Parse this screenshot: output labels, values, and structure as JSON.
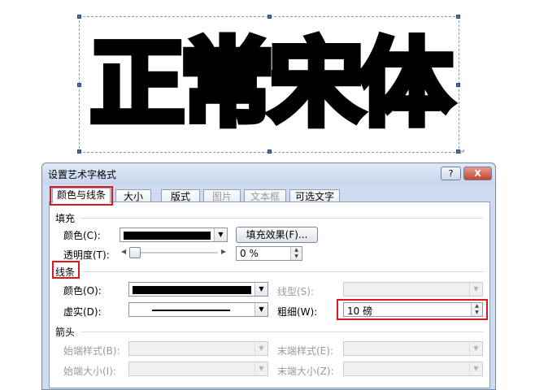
{
  "wordart": {
    "text": "正常宋体"
  },
  "dialog": {
    "title": "设置艺术字格式",
    "help_label": "?",
    "close_label": "X",
    "tabs": [
      {
        "label": "颜色与线条",
        "active": true,
        "enabled": true
      },
      {
        "label": "大小",
        "active": false,
        "enabled": true
      },
      {
        "label": "版式",
        "active": false,
        "enabled": true
      },
      {
        "label": "图片",
        "active": false,
        "enabled": false
      },
      {
        "label": "文本框",
        "active": false,
        "enabled": false
      },
      {
        "label": "可选文字",
        "active": false,
        "enabled": true
      }
    ],
    "fill": {
      "section_label": "填充",
      "color_label": "颜色(C):",
      "color_value": "#000000",
      "effects_button": "填充效果(F)...",
      "transparency_label": "透明度(T):",
      "transparency_value": "0 %",
      "transparency_percent": 0
    },
    "line": {
      "section_label": "线条",
      "color_label": "颜色(O):",
      "color_value": "#000000",
      "style_label": "线型(S):",
      "dash_label": "虚实(D):",
      "weight_label": "粗细(W):",
      "weight_value": "10 磅"
    },
    "arrows": {
      "section_label": "箭头",
      "begin_style_label": "始端样式(B):",
      "end_style_label": "末端样式(E):",
      "begin_size_label": "始端大小(I):",
      "end_size_label": "末端大小(Z):"
    }
  },
  "highlight_color": "#e0161c"
}
